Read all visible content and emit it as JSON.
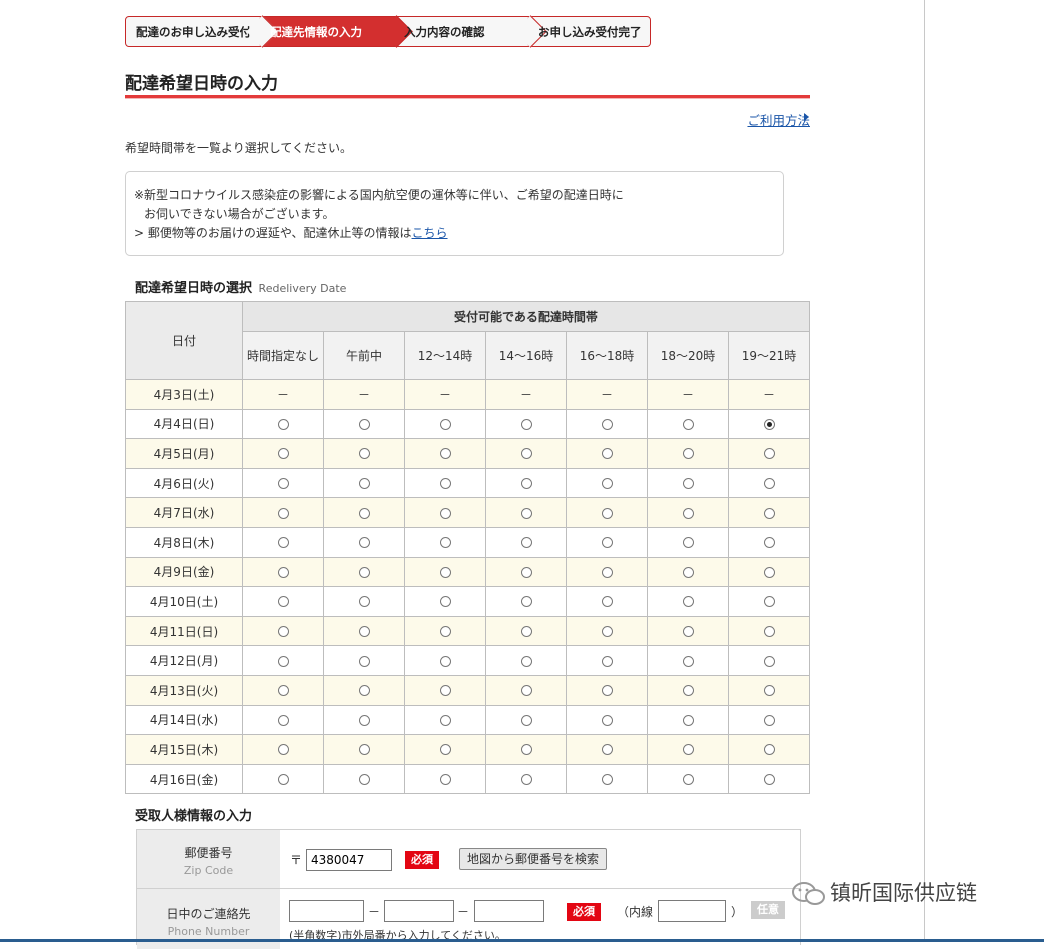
{
  "steps": [
    "配達のお申し込み受付",
    "配達先情報の入力",
    "入力内容の確認",
    "お申し込み受付完了"
  ],
  "page_title": "配達希望日時の入力",
  "help_link": "ご利用方法",
  "intro": "希望時間帯を一覧より選択してください。",
  "notice": {
    "line1": "※新型コロナウイルス感染症の影響による国内航空便の運休等に伴い、ご希望の配達日時に",
    "line2": "お伺いできない場合がございます。",
    "line3_prefix": "> 郵便物等のお届けの遅延や、配達休止等の情報は",
    "line3_link": "こちら"
  },
  "section_title": "配達希望日時の選択",
  "section_title_en": "Redelivery Date",
  "table": {
    "date_header": "日付",
    "group_header": "受付可能である配達時間帯",
    "slots": [
      "時間指定なし",
      "午前中",
      "12～14時",
      "14～16時",
      "16～18時",
      "18～20時",
      "19～21時"
    ],
    "dash": "－",
    "rows": [
      {
        "date": "4月3日(土)",
        "available": false
      },
      {
        "date": "4月4日(日)",
        "available": true,
        "selected": 6
      },
      {
        "date": "4月5日(月)",
        "available": true
      },
      {
        "date": "4月6日(火)",
        "available": true
      },
      {
        "date": "4月7日(水)",
        "available": true
      },
      {
        "date": "4月8日(木)",
        "available": true
      },
      {
        "date": "4月9日(金)",
        "available": true
      },
      {
        "date": "4月10日(土)",
        "available": true
      },
      {
        "date": "4月11日(日)",
        "available": true
      },
      {
        "date": "4月12日(月)",
        "available": true
      },
      {
        "date": "4月13日(火)",
        "available": true
      },
      {
        "date": "4月14日(水)",
        "available": true
      },
      {
        "date": "4月15日(木)",
        "available": true
      },
      {
        "date": "4月16日(金)",
        "available": true
      }
    ]
  },
  "recipient": {
    "title": "受取人様情報の入力",
    "zip_label": "郵便番号",
    "zip_label_en": "Zip Code",
    "zip_mark": "〒",
    "zip_value": "4380047",
    "required": "必須",
    "zip_search_button": "地図から郵便番号を検索",
    "phone_label": "日中のご連絡先",
    "phone_label_en": "Phone Number",
    "phone_sep": "－",
    "ext_open": "（内線",
    "ext_close": "）",
    "optional": "任意",
    "phone_note": "(半角数字)市外局番から入力してください。"
  },
  "watermark": "镇昕国际供应链"
}
